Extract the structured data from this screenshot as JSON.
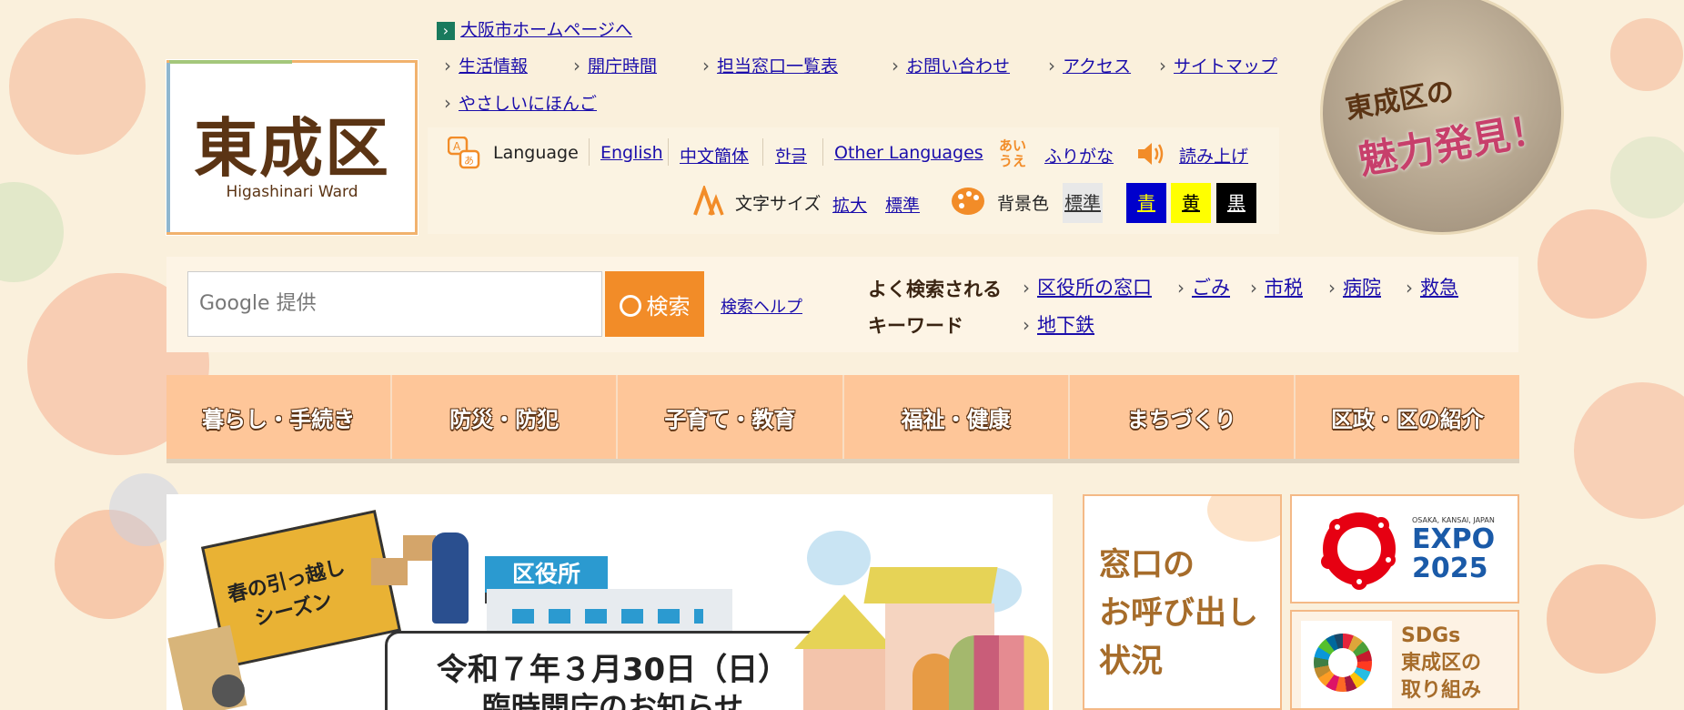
{
  "header": {
    "osaka_home_link": "大阪市ホームページへ",
    "top_links": [
      "生活情報",
      "開庁時間",
      "担当窓口一覧表",
      "お問い合わせ",
      "アクセス",
      "サイトマップ"
    ],
    "easy_japanese": "やさしいにほんご"
  },
  "logo": {
    "name_jp": "東成区",
    "name_en": "Higashinari Ward"
  },
  "tools": {
    "language_label": "Language",
    "languages": [
      "English",
      "中文簡体",
      "한글",
      "Other Languages"
    ],
    "furigana_icon_text": "あい\nうえ",
    "furigana": "ふりがな",
    "read_aloud": "読み上げ",
    "text_size_label": "文字サイズ",
    "text_size_enlarge": "拡大",
    "text_size_standard": "標準",
    "bg_color_label": "背景色",
    "bg_options": [
      {
        "label": "標準",
        "bg": "#e8e8e8",
        "fg": "#333333"
      },
      {
        "label": "青",
        "bg": "#0000cc",
        "fg": "#ffff00"
      },
      {
        "label": "黄",
        "bg": "#ffff00",
        "fg": "#000000"
      },
      {
        "label": "黒",
        "bg": "#000000",
        "fg": "#ffffff"
      }
    ]
  },
  "search": {
    "placeholder": "Google 提供",
    "button": "検索",
    "help": "検索ヘルプ",
    "keywords_label_1": "よく検索される",
    "keywords_label_2": "キーワード",
    "keywords_row1": [
      "区役所の窓口",
      "ごみ",
      "市税",
      "病院",
      "救急"
    ],
    "keywords_row2": [
      "地下鉄"
    ]
  },
  "nav": [
    "暮らし・手続き",
    "防災・防犯",
    "子育て・教育",
    "福祉・健康",
    "まちづくり",
    "区政・区の紹介"
  ],
  "banner": {
    "sign_text": "区役所",
    "truck_text_1": "春の引っ越し",
    "truck_text_2": "シーズン",
    "date_text": "令和７年３月30日（日）",
    "notice_text": "臨時開庁のお知らせ"
  },
  "sidebox": {
    "line1": "窓口の",
    "line2": "お呼び出し",
    "line3": "状況"
  },
  "expo": {
    "small": "OSAKA, KANSAI, JAPAN",
    "title": "EXPO",
    "year": "2025"
  },
  "sdgs": {
    "line1": "SDGs",
    "line2": "東成区の",
    "line3": "取り組み"
  },
  "charm": {
    "line1": "東成区の",
    "line2": "魅力発見！"
  },
  "colors": {
    "accent_orange": "#f28c28",
    "nav_bg": "#fec699",
    "brown": "#5b3414",
    "link": "#1a0dab"
  }
}
